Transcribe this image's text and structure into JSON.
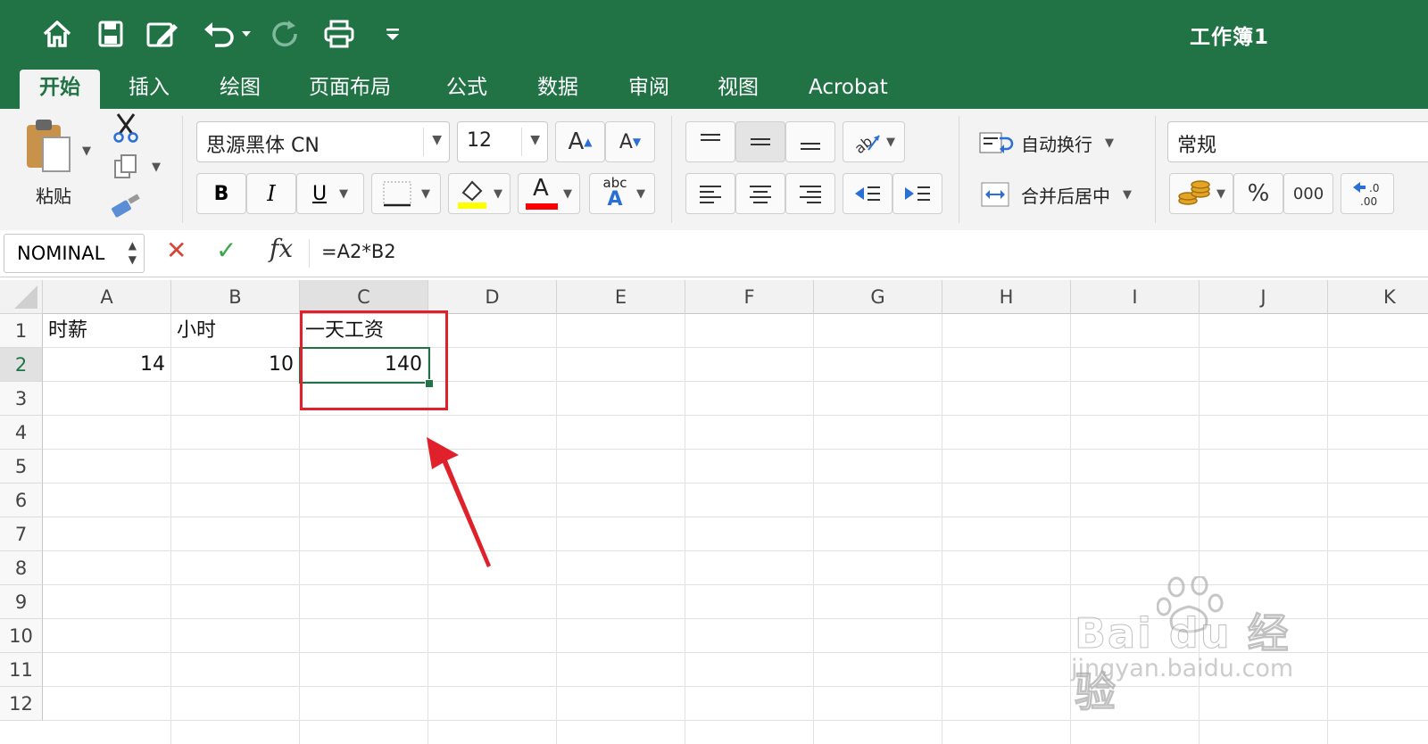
{
  "window": {
    "title": "工作簿1"
  },
  "quick_access": {
    "icons": [
      "home-icon",
      "save-icon",
      "edit-document-icon",
      "undo-icon",
      "redo-icon",
      "print-icon",
      "customize-toolbar-icon"
    ]
  },
  "tabs": [
    {
      "label": "开始",
      "active": true
    },
    {
      "label": "插入"
    },
    {
      "label": "绘图"
    },
    {
      "label": "页面布局"
    },
    {
      "label": "公式"
    },
    {
      "label": "数据"
    },
    {
      "label": "审阅"
    },
    {
      "label": "视图"
    },
    {
      "label": "Acrobat"
    }
  ],
  "ribbon": {
    "paste_label": "粘贴",
    "font_name": "思源黑体 CN",
    "font_size": "12",
    "bold": "B",
    "italic": "I",
    "underline": "U",
    "font_color_letter": "A",
    "phonetic_top": "abc",
    "phonetic_bottom": "A",
    "grow_font": "A",
    "shrink_font": "A",
    "wrap_text": "自动换行",
    "merge_center": "合并后居中",
    "number_format": "常规",
    "percent": "%",
    "thousands": "000",
    "colors": {
      "highlight": "#ffff00",
      "font_color": "#ff0000"
    }
  },
  "formula_bar": {
    "name_box": "NOMINAL",
    "cancel": "✕",
    "enter": "✓",
    "fx": "fx",
    "formula": "=A2*B2"
  },
  "sheet": {
    "columns": [
      "A",
      "B",
      "C",
      "D",
      "E",
      "F",
      "G",
      "H",
      "I",
      "J",
      "K"
    ],
    "rows": [
      "1",
      "2",
      "3",
      "4",
      "5",
      "6",
      "7",
      "8",
      "9",
      "10",
      "11",
      "12"
    ],
    "cells": {
      "A1": "时薪",
      "B1": "小时",
      "C1": "一天工资",
      "A2": "14",
      "B2": "10",
      "C2": "140"
    },
    "active_cell": "C2"
  },
  "watermark": {
    "brand": "Bai du 经验",
    "url": "jingyan.baidu.com"
  },
  "accent": "#217346",
  "annotation_color": "#e0202a"
}
